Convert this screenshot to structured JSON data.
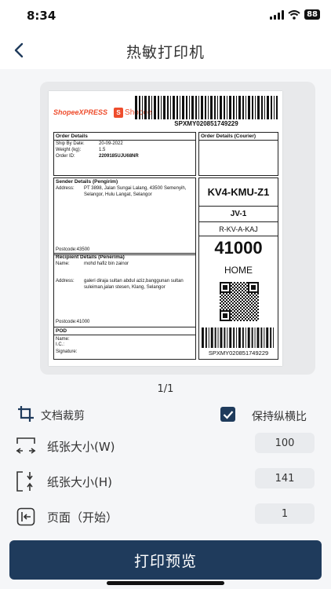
{
  "status_bar": {
    "time": "8:34",
    "battery": "88"
  },
  "nav": {
    "title": "热敏打印机"
  },
  "label": {
    "brand_xpress": "ShopeeXPRESS",
    "brand_shopee": "Shopee",
    "tracking_no": "SPXMY020851749229",
    "order_details": {
      "title": "Order Details",
      "rows": [
        {
          "k": "Ship By Date:",
          "v": "20-09-2022"
        },
        {
          "k": "Weight (kg):",
          "v": "1.5"
        },
        {
          "k": "Order ID:",
          "v": "2209185UJU68NR"
        }
      ]
    },
    "courier_title": "Order Details (Courier)",
    "sender": {
      "title": "Sender Details (Pengirim)",
      "address_label": "Address:",
      "address": "PT 3898, Jalan Sungai Lalang, 43500 Semenyih, Selangor, Hulu Langat, Selangor",
      "postcode": "Postcode:43500"
    },
    "recipient": {
      "title": "Recipient Details (Penerima)",
      "name_label": "Name:",
      "name": "mohd hafiz bin zainor",
      "address_label": "Address:",
      "address": "galeri diraja sultan abdul aziz,banggunan sultan suleiman,jalan stesen, Klang, Selangor",
      "postcode": "Postcode:41000"
    },
    "pod": {
      "title": "POD",
      "name": "Name:",
      "ic": "I.C.:",
      "signature": "Signature:"
    },
    "route_code": "KV4-KMU-Z1",
    "hub": "JV-1",
    "zone": "R-KV-A-KAJ",
    "postcode_big": "41000",
    "delivery_type": "HOME"
  },
  "page_indicator": "1/1",
  "settings": {
    "crop_label": "文档裁剪",
    "keep_ratio_label": "保持纵横比",
    "width_label": "纸张大小(W)",
    "width_value": "100",
    "height_label": "纸张大小(H)",
    "height_value": "141",
    "page_label": "页面（开始）",
    "page_value": "1"
  },
  "print_button": "打印预览",
  "colors": {
    "primary": "#1f3b5c",
    "shopee": "#ee4d2d"
  }
}
